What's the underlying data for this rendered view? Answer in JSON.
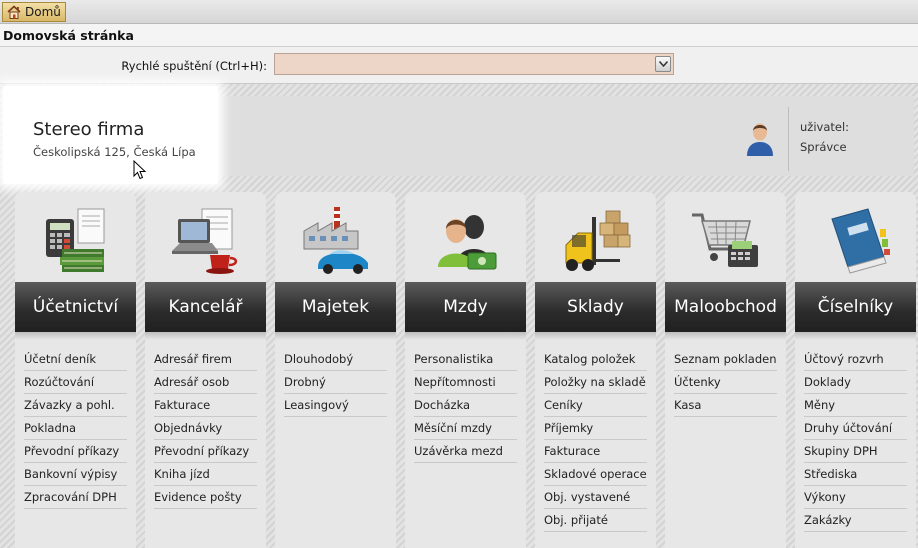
{
  "tab": {
    "label": "Domů",
    "icon": "home-icon"
  },
  "page_title": "Domovská stránka",
  "quick_launch": {
    "label": "Rychlé spuštění (Ctrl+H):",
    "value": ""
  },
  "company": {
    "name": "Stereo firma",
    "address": "Českolipská 125, Česká Lípa"
  },
  "user": {
    "label": "uživatel:",
    "name": "Správce",
    "icon": "user-avatar-icon"
  },
  "modules": [
    {
      "title": "Účetnictví",
      "icon": "accounting-icon",
      "items": [
        "Účetní deník",
        "Rozúčtování",
        "Závazky a pohl.",
        "Pokladna",
        "Převodní příkazy",
        "Bankovní výpisy",
        "Zpracování DPH"
      ]
    },
    {
      "title": "Kancelář",
      "icon": "office-icon",
      "items": [
        "Adresář firem",
        "Adresář osob",
        "Fakturace",
        "Objednávky",
        "Převodní příkazy",
        "Kniha jízd",
        "Evidence pošty"
      ]
    },
    {
      "title": "Majetek",
      "icon": "assets-icon",
      "items": [
        "Dlouhodobý",
        "Drobný",
        "Leasingový"
      ]
    },
    {
      "title": "Mzdy",
      "icon": "payroll-icon",
      "items": [
        "Personalistika",
        "Nepřítomnosti",
        "Docházka",
        "Měsíční mzdy",
        "Uzávěrka mezd"
      ]
    },
    {
      "title": "Sklady",
      "icon": "warehouse-icon",
      "items": [
        "Katalog položek",
        "Položky na skladě",
        "Ceníky",
        "Příjemky",
        "Fakturace",
        "Skladové operace",
        "Obj. vystavené",
        "Obj. přijaté"
      ]
    },
    {
      "title": "Maloobchod",
      "icon": "retail-icon",
      "items": [
        "Seznam pokladen",
        "Účtenky",
        "Kasa"
      ]
    },
    {
      "title": "Číselníky",
      "icon": "codebook-icon",
      "items": [
        "Účtový rozvrh",
        "Doklady",
        "Měny",
        "Druhy účtování",
        "Skupiny DPH",
        "Střediska",
        "Výkony",
        "Zakázky"
      ]
    }
  ]
}
